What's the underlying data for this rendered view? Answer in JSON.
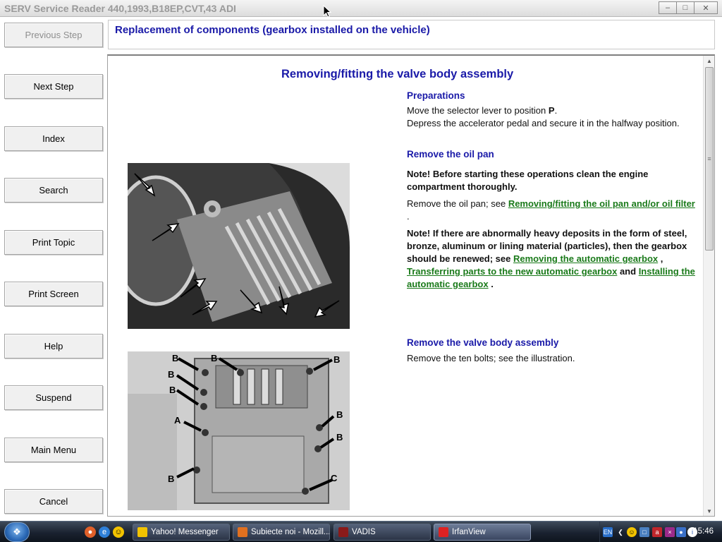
{
  "window": {
    "title": "SERV Service Reader 440,1993,B18EP,CVT,43 ADI",
    "controls": [
      "minimize",
      "maximize",
      "close"
    ]
  },
  "sidebar": {
    "buttons": [
      {
        "label": "Previous Step",
        "enabled": false
      },
      {
        "label": "Next Step",
        "enabled": true
      },
      {
        "label": "Index",
        "enabled": true
      },
      {
        "label": "Search",
        "enabled": true
      },
      {
        "label": "Print Topic",
        "enabled": true
      },
      {
        "label": "Print Screen",
        "enabled": true
      },
      {
        "label": "Help",
        "enabled": true
      },
      {
        "label": "Suspend",
        "enabled": true
      },
      {
        "label": "Main Menu",
        "enabled": true
      },
      {
        "label": "Cancel",
        "enabled": true
      }
    ]
  },
  "topic": {
    "title": "Replacement of components (gearbox installed on the vehicle)"
  },
  "content": {
    "section_title": "Removing/fitting the valve body assembly",
    "preparations": {
      "heading": "Preparations",
      "line1_prefix": "Move the selector lever to position ",
      "line1_bold": "P",
      "line1_suffix": ".",
      "line2": "Depress the accelerator pedal and secure it in the halfway position."
    },
    "oil_pan": {
      "heading": "Remove the oil pan",
      "note1": "Note! Before starting these operations clean the engine compartment thoroughly.",
      "para_prefix": "Remove the oil pan; see ",
      "para_link": "Removing/fitting the oil pan and/or oil filter",
      "para_suffix": " .",
      "note2_prefix": "Note! If there are abnormally heavy deposits in the form of steel, bronze, aluminum or lining material (particles), then the gearbox should be renewed; see ",
      "note2_link1": "Removing the automatic gearbox",
      "note2_sep1": " , ",
      "note2_link2": "Transferring parts to the new automatic gearbox",
      "note2_sep2": " and ",
      "note2_link3": "Installing the automatic gearbox",
      "note2_suffix": " ."
    },
    "valve_body": {
      "heading": "Remove the valve body assembly",
      "para": "Remove the ten bolts; see the illustration."
    },
    "figure2_labels": [
      "B",
      "B",
      "B",
      "B",
      "B",
      "B",
      "B",
      "B",
      "A",
      "C"
    ]
  },
  "taskbar": {
    "items": [
      {
        "label": "Yahoo! Messenger",
        "active": false
      },
      {
        "label": "Subiecte noi - Mozill...",
        "active": false
      },
      {
        "label": "VADIS",
        "active": false
      },
      {
        "label": "IrfanView",
        "active": true
      }
    ],
    "lang": "EN",
    "clock": "15:46"
  },
  "colors": {
    "heading_blue": "#1a1aa8",
    "link_green": "#1a7a1a"
  }
}
